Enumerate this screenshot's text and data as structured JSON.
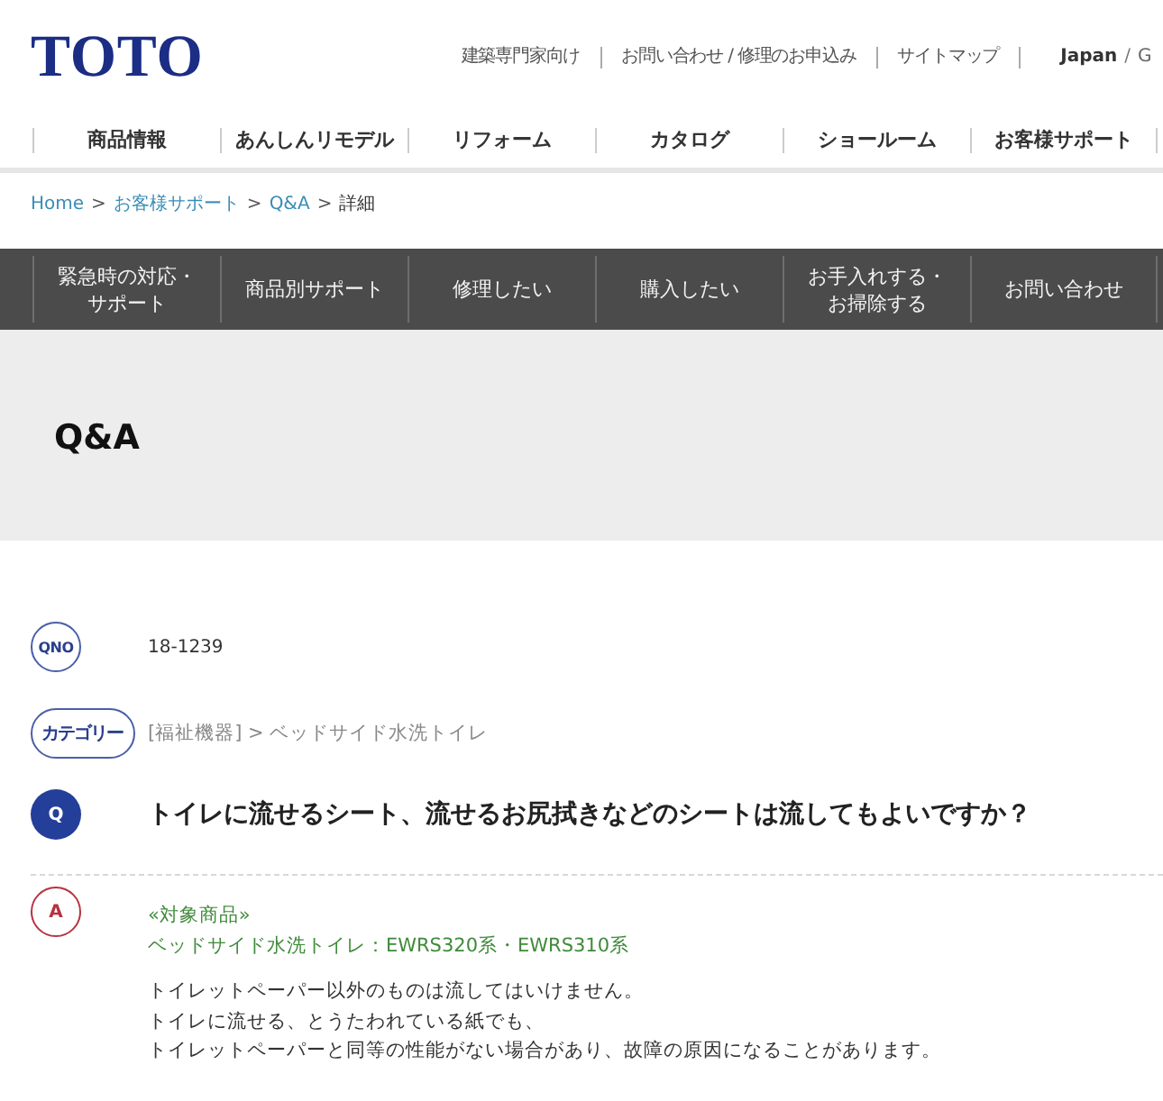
{
  "header": {
    "logo": "TOTO",
    "utility_links": [
      "建築専門家向け",
      "お問い合わせ / 修理のお申込み",
      "サイトマップ"
    ],
    "languages": {
      "options": [
        {
          "label": "Japan",
          "selected": true
        },
        {
          "label": "G",
          "selected": false
        }
      ],
      "separator": "/"
    }
  },
  "main_nav": [
    "商品情報",
    "あんしんリモデル",
    "リフォーム",
    "カタログ",
    "ショールーム",
    "お客様サポート"
  ],
  "breadcrumb": [
    {
      "kind": "link",
      "label": "Home"
    },
    {
      "kind": "separator",
      "label": ">"
    },
    {
      "kind": "link",
      "label": "お客様サポート"
    },
    {
      "kind": "separator",
      "label": ">"
    },
    {
      "kind": "link",
      "label": "Q&A"
    },
    {
      "kind": "separator",
      "label": ">"
    },
    {
      "kind": "current",
      "label": "詳細"
    }
  ],
  "support_menu": [
    "緊急時の対応・サポート",
    "商品別サポート",
    "修理したい",
    "購入したい",
    "お手入れする・お掃除する",
    "お問い合わせ"
  ],
  "page_title": "Q&A",
  "qa": {
    "qno": {
      "badge": "QNO",
      "value": "18-1239"
    },
    "category": {
      "badge": "カテゴリー",
      "path": "[福祉機器] > ベッドサイド水洗トイレ"
    },
    "question": {
      "badge": "Q",
      "text": "トイレに流せるシート、流せるお尻拭きなどのシートは流してもよいですか？"
    },
    "answer": {
      "badge": "A",
      "target_heading": "«対象商品»",
      "target_products": "ベッドサイド水洗トイレ：EWRS320系・EWRS310系",
      "body": [
        "トイレットペーパー以外のものは流してはいけません。",
        "トイレに流せる、とうたわれている紙でも、",
        "トイレットペーパーと同等の性能がない場合があり、故障の原因になることがあります。"
      ]
    }
  }
}
